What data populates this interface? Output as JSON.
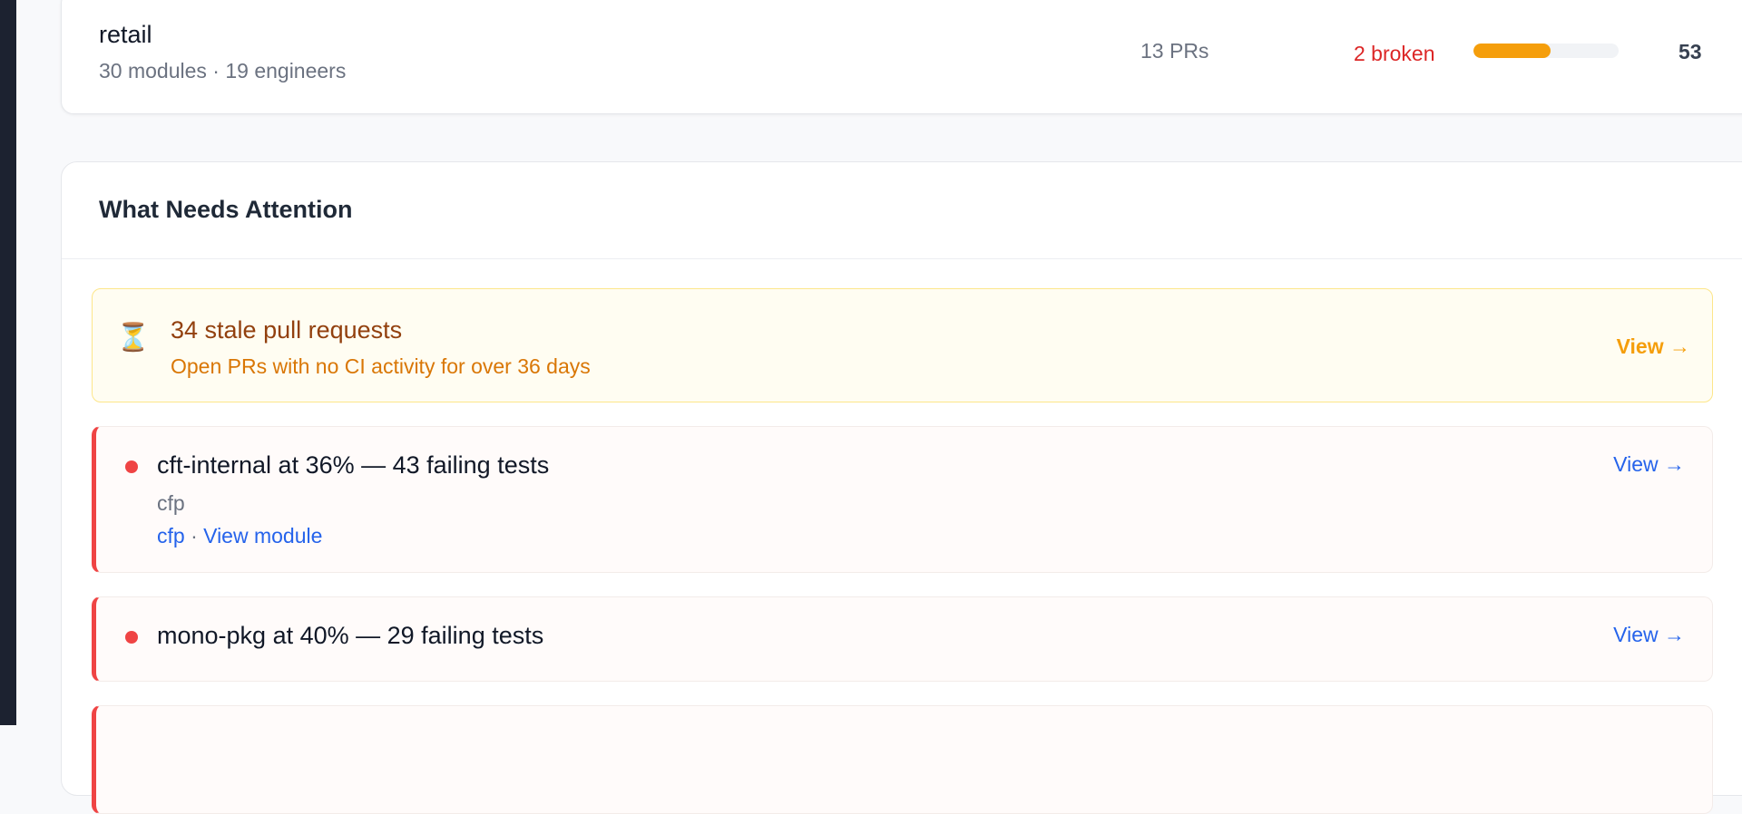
{
  "team": {
    "name": "retail",
    "meta": "30 modules · 19 engineers",
    "prs": "13 PRs",
    "broken": "2 broken",
    "progress_percent": 53,
    "score": "53"
  },
  "attention": {
    "title": "What Needs Attention",
    "stale": {
      "icon": "hourglass-icon",
      "glyph": "⏳",
      "title": "34 stale pull requests",
      "subtitle": "Open PRs with no CI activity for over 36 days",
      "view_label": "View →"
    },
    "issues": [
      {
        "title": "cft-internal at 36% — 43 failing tests",
        "team": "cfp",
        "link_team": "cfp",
        "separator": "·",
        "link_module": "View module",
        "view_label": "View →"
      },
      {
        "title": "mono-pkg at 40% — 29 failing tests",
        "view_label": "View →"
      }
    ]
  },
  "colors": {
    "accent_blue": "#2563eb",
    "danger_red": "#ef4444",
    "warning_amber": "#f59e0b",
    "sidebar_dark": "#1c2230"
  }
}
